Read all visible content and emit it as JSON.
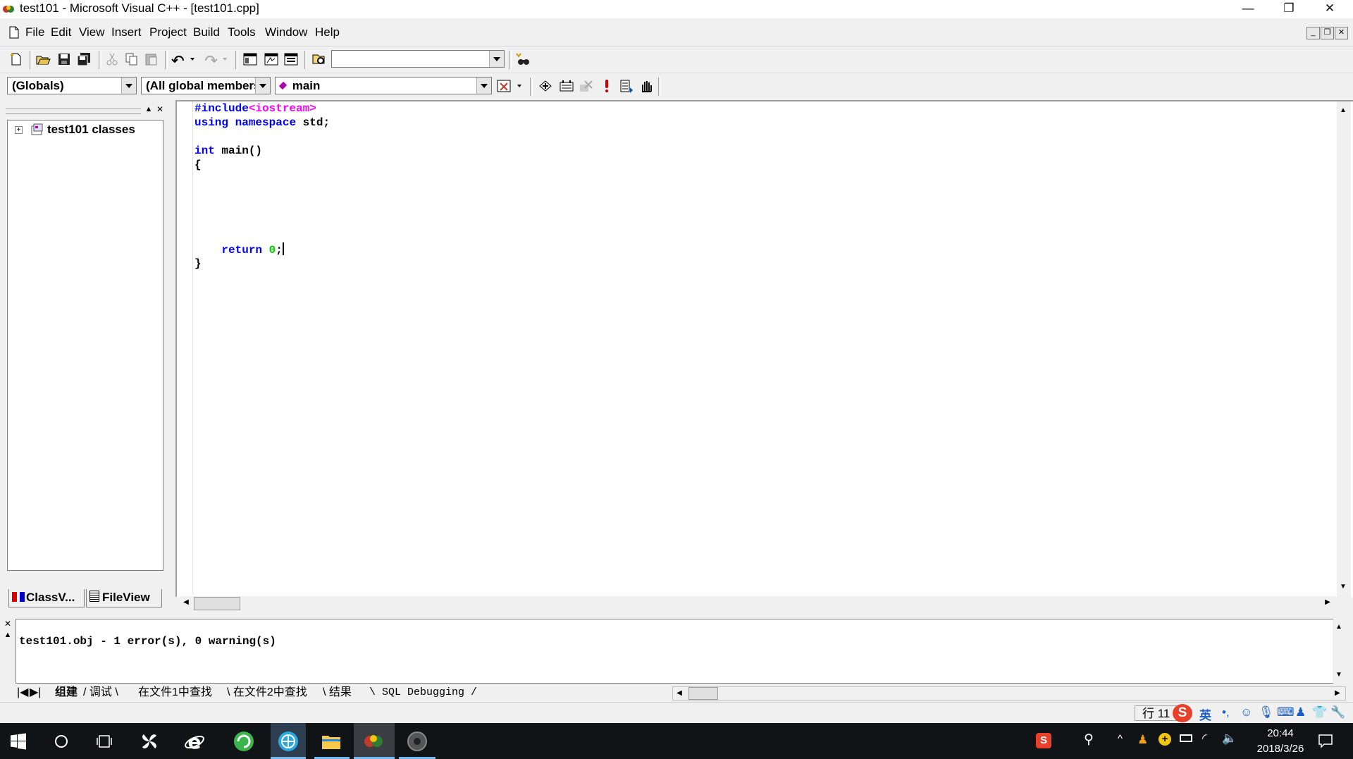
{
  "window": {
    "title": "test101 - Microsoft Visual C++ - [test101.cpp]",
    "minimize": "—",
    "restore": "❐",
    "close": "✕"
  },
  "menu": {
    "items": [
      "File",
      "Edit",
      "View",
      "Insert",
      "Project",
      "Build",
      "Tools",
      "Window",
      "Help"
    ]
  },
  "toolbar": {
    "find_value": "",
    "scope_combo": "(Globals)",
    "members_combo": "(All global members",
    "function_combo": "main"
  },
  "workspace": {
    "tree_root": "test101 classes",
    "tabs": [
      "ClassV...",
      "FileView"
    ]
  },
  "editor": {
    "lines": [
      [
        {
          "t": "#include",
          "c": "kw"
        },
        {
          "t": "<iostream>",
          "c": "str"
        }
      ],
      [
        {
          "t": "using",
          "c": "kw"
        },
        {
          "t": " "
        },
        {
          "t": "namespace",
          "c": "kw"
        },
        {
          "t": " std;"
        }
      ],
      [],
      [
        {
          "t": "int",
          "c": "kw"
        },
        {
          "t": " main()"
        }
      ],
      [
        {
          "t": "{"
        }
      ],
      [],
      [],
      [],
      [],
      [],
      [
        {
          "t": "    "
        },
        {
          "t": "return",
          "c": "kw"
        },
        {
          "t": " "
        },
        {
          "t": "0",
          "c": "num"
        },
        {
          "t": ";"
        },
        {
          "t": "",
          "c": "caret"
        }
      ],
      [
        {
          "t": "}"
        }
      ]
    ]
  },
  "output": {
    "message": "test101.obj - 1 error(s), 0 warning(s)",
    "tabs": [
      "组建",
      "调试",
      "在文件1中查找",
      "在文件2中查找",
      "结果",
      "SQL Debugging"
    ]
  },
  "statusbar": {
    "line_indicator": "行 11",
    "ime_lang": "英"
  },
  "taskbar": {
    "time": "20:44",
    "date": "2018/3/26"
  },
  "colors": {
    "keyword": "#0000ff",
    "string": "#ff00ff",
    "number": "#00cc00",
    "taskbar": "#111417",
    "taskbar_active": "#76b9ed"
  }
}
